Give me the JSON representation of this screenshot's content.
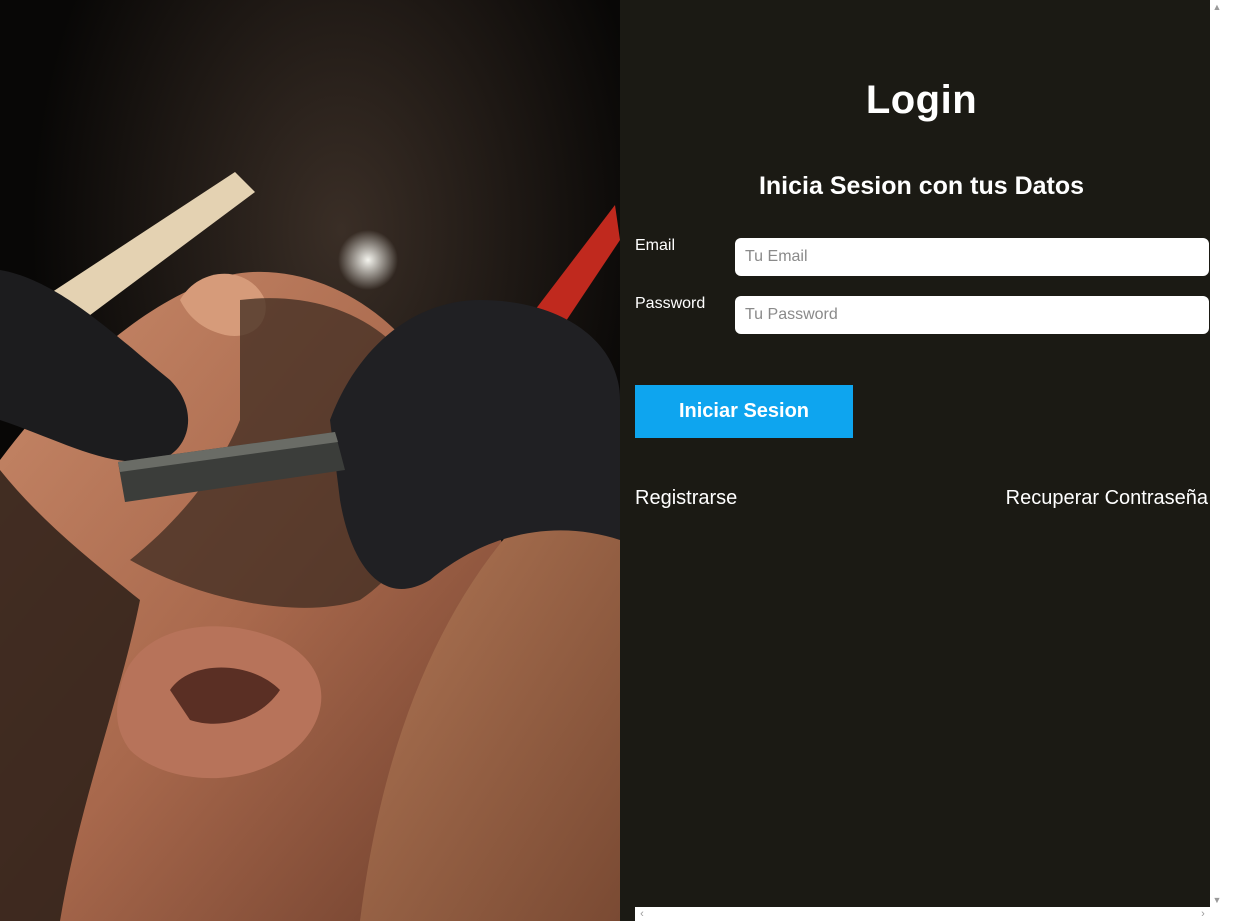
{
  "hero_image": {
    "description_icon": "barber-shaving-photo"
  },
  "login": {
    "title": "Login",
    "subtitle": "Inicia Sesion con tus Datos",
    "email_label": "Email",
    "email_placeholder": "Tu Email",
    "email_value": "",
    "password_label": "Password",
    "password_placeholder": "Tu Password",
    "password_value": "",
    "submit_label": "Iniciar Sesion",
    "register_link": "Registrarse",
    "recover_link": "Recuperar Contraseña"
  },
  "scrollbars": {
    "up_icon": "▲",
    "down_icon": "▼",
    "left_icon": "‹",
    "right_icon": "›"
  },
  "colors": {
    "panel_bg": "#1b1a14",
    "button_bg": "#0ea5ef",
    "text": "#ffffff"
  }
}
